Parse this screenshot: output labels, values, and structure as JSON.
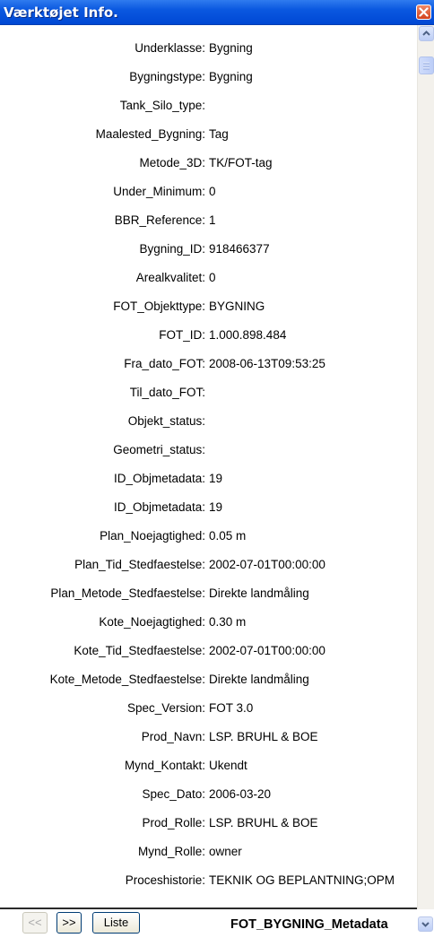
{
  "window": {
    "title": "Værktøjet Info."
  },
  "rows": [
    {
      "label": "Underklasse:",
      "value": "Bygning"
    },
    {
      "label": "Bygningstype:",
      "value": "Bygning"
    },
    {
      "label": "Tank_Silo_type:",
      "value": ""
    },
    {
      "label": "Maalested_Bygning:",
      "value": "Tag"
    },
    {
      "label": "Metode_3D:",
      "value": "TK/FOT-tag"
    },
    {
      "label": "Under_Minimum:",
      "value": "0"
    },
    {
      "label": "BBR_Reference:",
      "value": "1"
    },
    {
      "label": "Bygning_ID:",
      "value": "918466377"
    },
    {
      "label": "Arealkvalitet:",
      "value": "0"
    },
    {
      "label": "FOT_Objekttype:",
      "value": "BYGNING"
    },
    {
      "label": "FOT_ID:",
      "value": "1.000.898.484"
    },
    {
      "label": "Fra_dato_FOT:",
      "value": "2008-06-13T09:53:25"
    },
    {
      "label": "Til_dato_FOT:",
      "value": ""
    },
    {
      "label": "Objekt_status:",
      "value": ""
    },
    {
      "label": "Geometri_status:",
      "value": ""
    },
    {
      "label": "ID_Objmetadata:",
      "value": "19"
    },
    {
      "label": "ID_Objmetadata:",
      "value": "19"
    },
    {
      "label": "Plan_Noejagtighed:",
      "value": "0.05 m"
    },
    {
      "label": "Plan_Tid_Stedfaestelse:",
      "value": "2002-07-01T00:00:00"
    },
    {
      "label": "Plan_Metode_Stedfaestelse:",
      "value": "Direkte landmåling"
    },
    {
      "label": "Kote_Noejagtighed:",
      "value": "0.30 m"
    },
    {
      "label": "Kote_Tid_Stedfaestelse:",
      "value": "2002-07-01T00:00:00"
    },
    {
      "label": "Kote_Metode_Stedfaestelse:",
      "value": "Direkte landmåling"
    },
    {
      "label": "Spec_Version:",
      "value": "FOT 3.0"
    },
    {
      "label": "Prod_Navn:",
      "value": "LSP. BRUHL & BOE"
    },
    {
      "label": "Mynd_Kontakt:",
      "value": "Ukendt"
    },
    {
      "label": "Spec_Dato:",
      "value": "2006-03-20"
    },
    {
      "label": "Prod_Rolle:",
      "value": "LSP. BRUHL & BOE"
    },
    {
      "label": "Mynd_Rolle:",
      "value": "owner"
    },
    {
      "label": "Proceshistorie:",
      "value": "TEKNIK OG BEPLANTNING;OPM"
    }
  ],
  "footer": {
    "prev_label": "<<",
    "next_label": ">>",
    "list_label": "Liste",
    "layer_name": "FOT_BYGNING_Metadata"
  },
  "colors": {
    "titlebar": "#0a58e0",
    "close": "#d2411c"
  }
}
